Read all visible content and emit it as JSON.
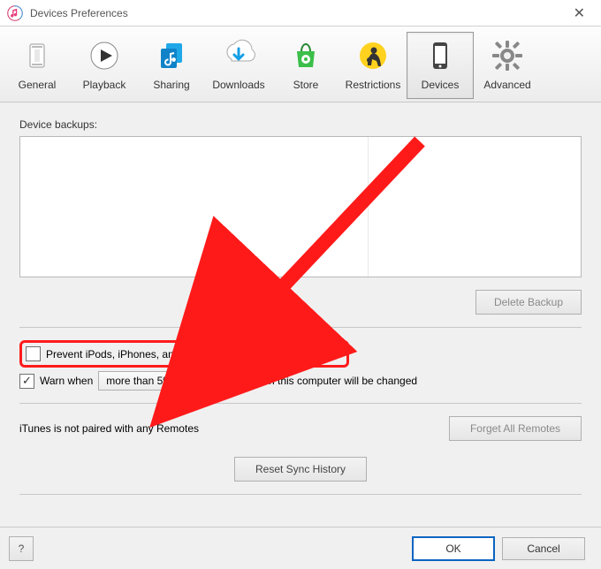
{
  "window": {
    "title": "Devices Preferences"
  },
  "tabs": [
    {
      "id": "general",
      "label": "General"
    },
    {
      "id": "playback",
      "label": "Playback"
    },
    {
      "id": "sharing",
      "label": "Sharing"
    },
    {
      "id": "downloads",
      "label": "Downloads"
    },
    {
      "id": "store",
      "label": "Store"
    },
    {
      "id": "restrictions",
      "label": "Restrictions"
    },
    {
      "id": "devices",
      "label": "Devices",
      "active": true
    },
    {
      "id": "advanced",
      "label": "Advanced"
    }
  ],
  "devices_panel": {
    "backups_label": "Device backups:",
    "delete_backup": "Delete Backup",
    "prevent_sync": {
      "checked": false,
      "label": "Prevent iPods, iPhones, and iPads from syncing automatically"
    },
    "warn_when": {
      "checked": true,
      "prefix": "Warn when",
      "selected": "more than 5%",
      "suffix": "of the data on this computer will be changed"
    },
    "remotes_status": "iTunes is not paired with any Remotes",
    "forget_remotes": "Forget All Remotes",
    "reset_sync_history": "Reset Sync History"
  },
  "footer": {
    "help": "?",
    "ok": "OK",
    "cancel": "Cancel"
  },
  "annotation": {
    "type": "arrow",
    "color": "#ff1a1a",
    "highlight_target": "prevent-sync-checkbox-row"
  }
}
